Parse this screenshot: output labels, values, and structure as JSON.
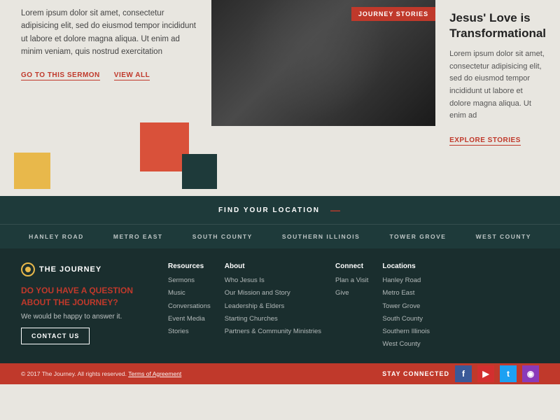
{
  "top": {
    "body_text": "Lorem ipsum dolor sit amet, consectetur adipisicing elit, sed do eiusmod tempor incididunt ut labore et dolore magna aliqua. Ut enim ad minim veniam, quis nostrud exercitation",
    "goto_sermon": "GO TO THIS SERMON",
    "view_all": "VIEW ALL"
  },
  "story": {
    "badge": "JOURNEY STORIES",
    "title": "Jesus' Love is Transformational",
    "body": "Lorem ipsum dolor sit amet, consectetur adipisicing elit, sed do eiusmod tempor incididunt ut labore et dolore magna aliqua. Ut enim ad",
    "explore_link": "EXPLORE STORIES"
  },
  "find_location": {
    "label": "FIND YOUR LOCATION",
    "dash": "—"
  },
  "location_tabs": [
    "HANLEY ROAD",
    "METRO EAST",
    "SOUTH COUNTY",
    "SOUTHERN ILLINOIS",
    "TOWER GROVE",
    "WEST COUNTY"
  ],
  "footer": {
    "brand_name": "THE JOURNEY",
    "question": "DO YOU HAVE A QUESTION ABOUT THE JOURNEY?",
    "question_sub": "We would be happy to answer it.",
    "contact_btn": "CONTACT US",
    "columns": [
      {
        "heading": "Resources",
        "links": [
          "Sermons",
          "Music",
          "Conversations",
          "Event Media",
          "Stories"
        ]
      },
      {
        "heading": "About",
        "links": [
          "Who Jesus Is",
          "Our Mission and Story",
          "Leadership & Elders",
          "Starting Churches",
          "Partners & Community Ministries"
        ]
      },
      {
        "heading": "Connect",
        "links": [
          "Plan a Visit",
          "Give"
        ]
      },
      {
        "heading": "Locations",
        "links": [
          "Hanley Road",
          "Metro East",
          "Tower Grove",
          "South County",
          "Southern Illinois",
          "West County"
        ]
      }
    ]
  },
  "footer_bottom": {
    "copyright": "© 2017 The Journey. All rights reserved.",
    "terms": "Terms of Agreement",
    "stay_connected": "STAY CONNECTED"
  }
}
